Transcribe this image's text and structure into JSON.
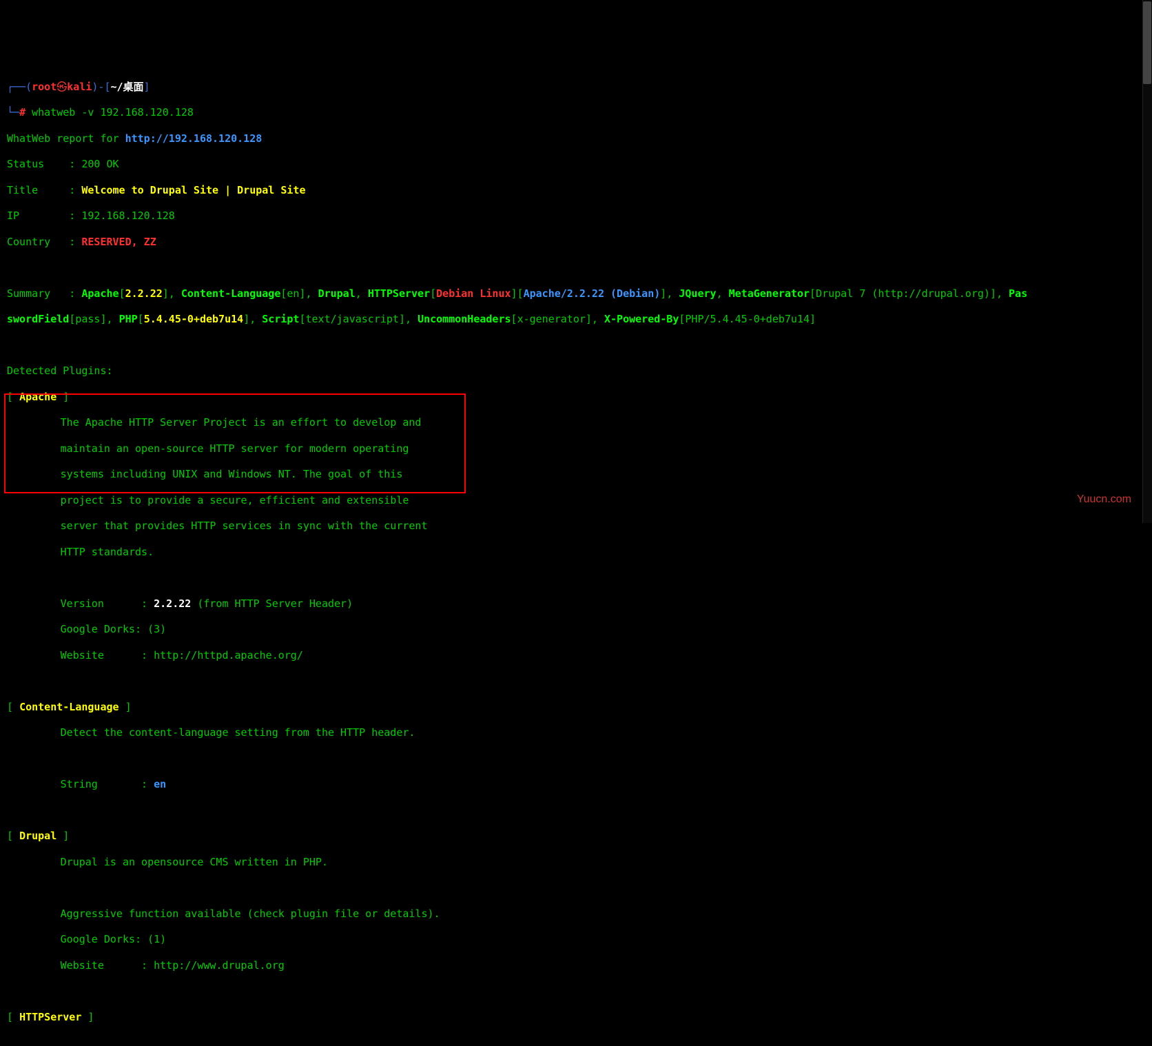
{
  "prompt": {
    "bracket_open": "┌──(",
    "user": "root",
    "skull": "㉿",
    "host": "kali",
    "bracket_mid": ")-[",
    "path": "~/桌面",
    "bracket_close": "]",
    "line2_prefix": "└─",
    "hash": "#",
    "command": "whatweb -v 192.168.120.128"
  },
  "report": {
    "header_label": "WhatWeb report for ",
    "url": "http://192.168.120.128",
    "status_label": "Status    : ",
    "status_value": "200 OK",
    "title_label": "Title     : ",
    "title_value": "Welcome to Drupal Site | Drupal Site",
    "ip_label": "IP        : ",
    "ip_value": "192.168.120.128",
    "country_label": "Country   : ",
    "country_value": "RESERVED, ZZ"
  },
  "summary": {
    "label": "Summary   : ",
    "apache": "Apache",
    "apache_v": "2.2.22",
    "clang": "Content-Language",
    "clang_v": "en",
    "drupal": "Drupal",
    "httpserver": "HTTPServer",
    "debian": "Debian Linux",
    "apachedeb": "Apache/2.2.22 (Debian)",
    "jquery": "JQuery",
    "metagen": "MetaGenerator",
    "metagen_v": "Drupal 7 (http://drupal.org)",
    "pass": "Pas",
    "swordfield": "swordField",
    "pass_v": "pass",
    "php": "PHP",
    "php_v": "5.4.45-0+deb7u14",
    "script": "Script",
    "script_v": "text/javascript",
    "unchdr": "UncommonHeaders",
    "unchdr_v": "x-generator",
    "xpow": "X-Powered-By",
    "xpow_v": "PHP/5.4.45-0+deb7u14"
  },
  "detected": {
    "header": "Detected Plugins:",
    "apache": {
      "name": "Apache",
      "d1": "The Apache HTTP Server Project is an effort to develop and",
      "d2": "maintain an open-source HTTP server for modern operating",
      "d3": "systems including UNIX and Windows NT. The goal of this",
      "d4": "project is to provide a secure, efficient and extensible",
      "d5": "server that provides HTTP services in sync with the current",
      "d6": "HTTP standards.",
      "version_label": "Version      : ",
      "version_value": "2.2.22",
      "version_suffix": " (from HTTP Server Header)",
      "dorks": "Google Dorks: (3)",
      "website": "Website      : http://httpd.apache.org/"
    },
    "clang": {
      "name": "Content-Language",
      "d1": "Detect the content-language setting from the HTTP header.",
      "string_label": "String       : ",
      "string_value": "en"
    },
    "drupal": {
      "name": "Drupal",
      "d1": "Drupal is an opensource CMS written in PHP.",
      "d2": "Aggressive function available (check plugin file or details).",
      "dorks": "Google Dorks: (1)",
      "website": "Website      : http://www.drupal.org"
    },
    "httpserver": {
      "name": "HTTPServer"
    }
  },
  "watermark": "Yuucn.com"
}
